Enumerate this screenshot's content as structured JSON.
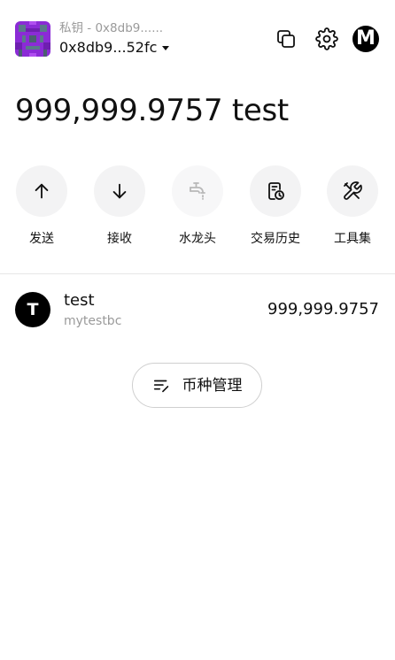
{
  "header": {
    "account_label": "私钥 - 0x8db9......",
    "account_address": "0x8db9...52fc",
    "avatar_icon": "pixel-avatar-icon",
    "copy_icon": "copy-icon",
    "settings_icon": "gear-icon",
    "logo_text": "M"
  },
  "balance": {
    "amount": "999,999.9757 test"
  },
  "actions": [
    {
      "label": "发送",
      "icon": "arrow-up-icon"
    },
    {
      "label": "接收",
      "icon": "arrow-down-icon"
    },
    {
      "label": "水龙头",
      "icon": "faucet-icon",
      "disabled": true
    },
    {
      "label": "交易历史",
      "icon": "history-icon"
    },
    {
      "label": "工具集",
      "icon": "tools-icon"
    }
  ],
  "tokens": [
    {
      "icon_letter": "T",
      "symbol": "test",
      "name": "mytestbc",
      "balance": "999,999.9757"
    }
  ],
  "manage": {
    "label": "币种管理",
    "icon": "list-edit-icon"
  },
  "colors": {
    "text": "#111111",
    "muted": "#9a9a9a",
    "action_bg": "#f3f3f4",
    "border": "#cfcfcf",
    "avatar_purple": "#8b2bd6"
  }
}
